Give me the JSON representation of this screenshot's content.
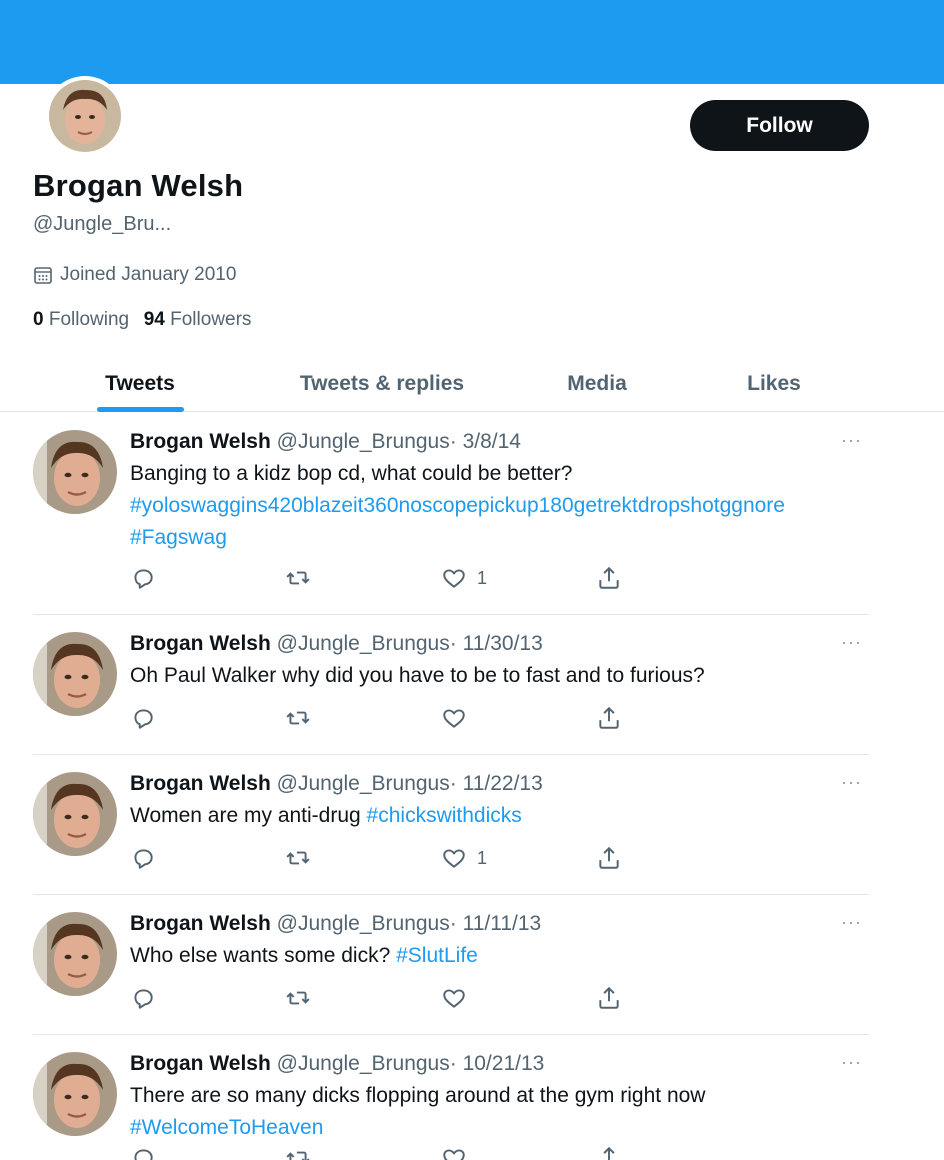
{
  "profile": {
    "name": "Brogan Welsh",
    "handle": "@Jungle_Bru...",
    "joined": "Joined January 2010",
    "following_count": "0",
    "following_label": "Following",
    "followers_count": "94",
    "followers_label": "Followers",
    "follow_label": "Follow"
  },
  "colors": {
    "banner": "#1d9bf0",
    "accent": "#1d9bf0",
    "text": "#0f1419",
    "muted": "#536471"
  },
  "tabs": [
    {
      "label": "Tweets"
    },
    {
      "label": "Tweets & replies"
    },
    {
      "label": "Media"
    },
    {
      "label": "Likes"
    }
  ],
  "tweets": [
    {
      "name": "Brogan Welsh",
      "handle": "@Jungle_Brungus",
      "date": "· 3/8/14",
      "text": "Banging to a kidz bop cd, what could be better?",
      "hashtags": [
        "#yoloswaggins420blazeit360noscopepickup180getrektdropshotggnore",
        "#Fagswag"
      ],
      "likes": "1",
      "more": "···"
    },
    {
      "name": "Brogan Welsh",
      "handle": "@Jungle_Brungus",
      "date": "· 11/30/13",
      "text": "Oh Paul Walker why did you have to be to fast and to furious?",
      "hashtags": [],
      "likes": "",
      "more": "···"
    },
    {
      "name": "Brogan Welsh",
      "handle": "@Jungle_Brungus",
      "date": "· 11/22/13",
      "text": "Women are my anti-drug ",
      "hashtags": [
        "#chickswithdicks"
      ],
      "likes": "1",
      "more": "···"
    },
    {
      "name": "Brogan Welsh",
      "handle": "@Jungle_Brungus",
      "date": "· 11/11/13",
      "text": "Who else wants some dick? ",
      "hashtags": [
        "#SlutLife"
      ],
      "likes": "",
      "more": "···"
    },
    {
      "name": "Brogan Welsh",
      "handle": "@Jungle_Brungus",
      "date": "· 10/21/13",
      "text": "There are so many dicks flopping around at the gym right now",
      "hashtags": [
        "#WelcomeToHeaven"
      ],
      "likes": "",
      "more": "···"
    }
  ]
}
